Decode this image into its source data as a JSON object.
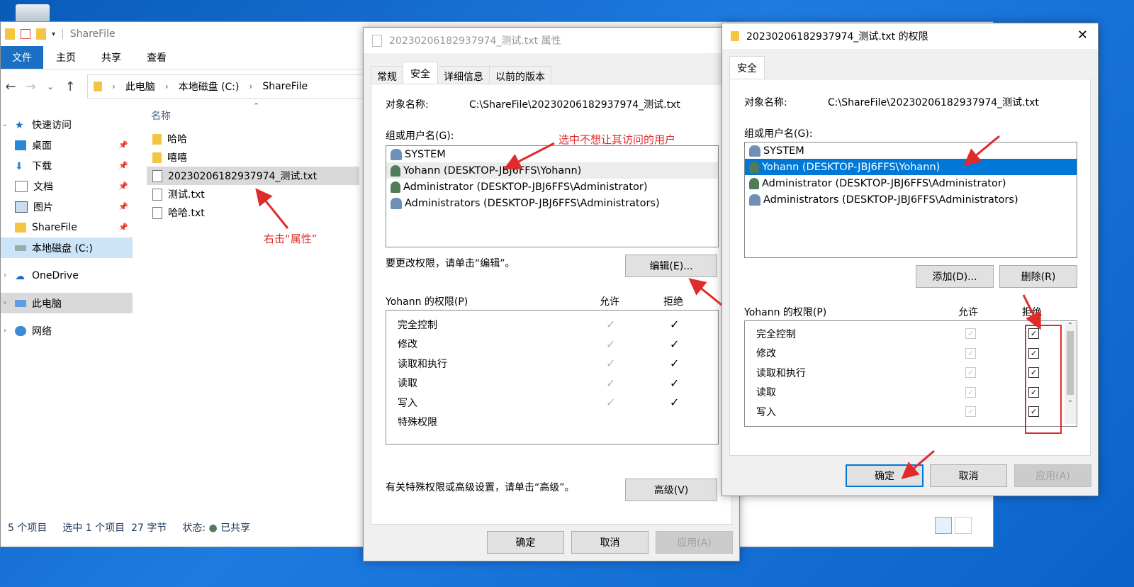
{
  "explorer": {
    "title": "ShareFile",
    "ribbon_tabs": [
      "文件",
      "主页",
      "共享",
      "查看"
    ],
    "breadcrumb": [
      "此电脑",
      "本地磁盘 (C:)",
      "ShareFile"
    ],
    "sidebar": [
      {
        "label": "快速访问",
        "icon": "star-icon"
      },
      {
        "label": "桌面",
        "icon": "desktop-icon"
      },
      {
        "label": "下载",
        "icon": "download-icon"
      },
      {
        "label": "文档",
        "icon": "document-icon"
      },
      {
        "label": "图片",
        "icon": "picture-icon"
      },
      {
        "label": "ShareFile",
        "icon": "folder-icon"
      },
      {
        "label": "本地磁盘 (C:)",
        "icon": "drive-icon"
      },
      {
        "label": "OneDrive",
        "icon": "cloud-icon"
      },
      {
        "label": "此电脑",
        "icon": "computer-icon"
      },
      {
        "label": "网络",
        "icon": "network-icon"
      }
    ],
    "column_name": "名称",
    "files": [
      "哈哈",
      "嘻嘻",
      "20230206182937974_测试.txt",
      "测试.txt",
      "哈哈.txt"
    ],
    "status": {
      "count": "5 个项目",
      "selected": "选中 1 个项目",
      "size": "27 字节",
      "state_label": "状态:",
      "state_value": "已共享"
    }
  },
  "properties": {
    "title": "20230206182937974_测试.txt 属性",
    "tabs": [
      "常规",
      "安全",
      "详细信息",
      "以前的版本"
    ],
    "object_label": "对象名称:",
    "object_value": "C:\\ShareFile\\20230206182937974_测试.txt",
    "group_label": "组或用户名(G):",
    "users": [
      "SYSTEM",
      "Yohann (DESKTOP-JBJ6FFS\\Yohann)",
      "Administrator (DESKTOP-JBJ6FFS\\Administrator)",
      "Administrators (DESKTOP-JBJ6FFS\\Administrators)"
    ],
    "edit_hint": "要更改权限，请单击“编辑”。",
    "edit_button": "编辑(E)...",
    "perm_label": "Yohann 的权限(P)",
    "allow": "允许",
    "deny": "拒绝",
    "perms": [
      "完全控制",
      "修改",
      "读取和执行",
      "读取",
      "写入",
      "特殊权限"
    ],
    "advanced_hint": "有关特殊权限或高级设置，请单击“高级”。",
    "advanced_button": "高级(V)",
    "ok": "确定",
    "cancel": "取消",
    "apply": "应用(A)"
  },
  "permissions": {
    "title": "20230206182937974_测试.txt 的权限",
    "tab": "安全",
    "object_label": "对象名称:",
    "object_value": "C:\\ShareFile\\20230206182937974_测试.txt",
    "group_label": "组或用户名(G):",
    "users": [
      "SYSTEM",
      "Yohann (DESKTOP-JBJ6FFS\\Yohann)",
      "Administrator (DESKTOP-JBJ6FFS\\Administrator)",
      "Administrators (DESKTOP-JBJ6FFS\\Administrators)"
    ],
    "add_button": "添加(D)...",
    "remove_button": "删除(R)",
    "perm_label": "Yohann 的权限(P)",
    "allow": "允许",
    "deny": "拒绝",
    "perms": [
      "完全控制",
      "修改",
      "读取和执行",
      "读取",
      "写入"
    ],
    "ok": "确定",
    "cancel": "取消",
    "apply": "应用(A)"
  },
  "annotations": {
    "right_click": "右击“属性”",
    "select_user": "选中不想让其访问的用户"
  },
  "colors": {
    "accent": "#0078d7",
    "annotation": "#e02b2b"
  }
}
